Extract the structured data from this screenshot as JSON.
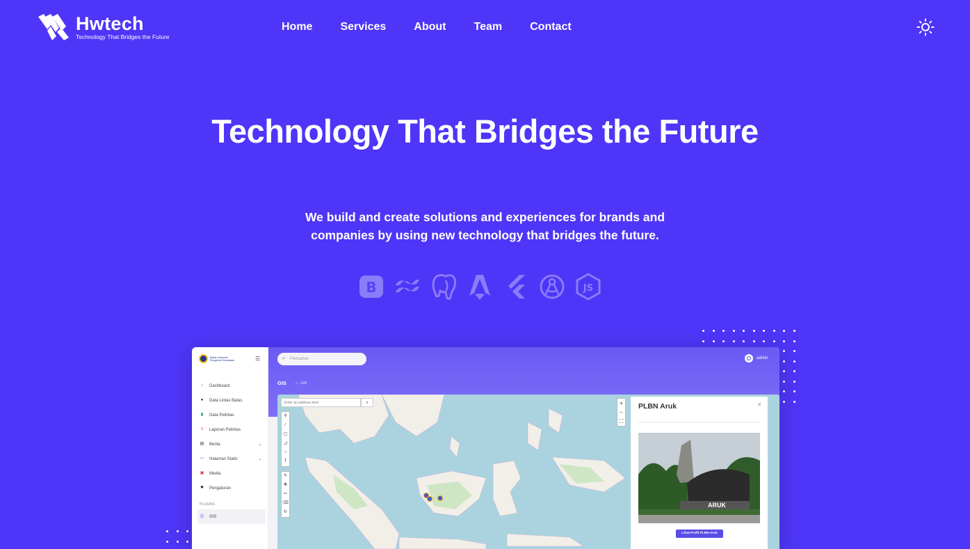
{
  "brand": {
    "name": "Hwtech",
    "tagline": "Technology That Bridges the Future"
  },
  "nav": {
    "items": [
      {
        "label": "Home"
      },
      {
        "label": "Services"
      },
      {
        "label": "About"
      },
      {
        "label": "Team"
      },
      {
        "label": "Contact"
      }
    ],
    "theme_toggle_icon": "sun-icon"
  },
  "hero": {
    "title": "Technology That Bridges the Future",
    "subtitle": "We build and create solutions and experiences for brands and companies by using new technology that bridges the future."
  },
  "tech_stack": {
    "icons": [
      "bootstrap-icon",
      "tailwind-icon",
      "postgresql-icon",
      "astro-icon",
      "flutter-icon",
      "compass-icon",
      "nodejs-icon"
    ],
    "color": "#8b7cf9"
  },
  "colors": {
    "background": "#4f35f7",
    "accent": "#6a5af5"
  },
  "mockup": {
    "sidebar": {
      "brand_text": "Badan Nasional Pengelola Perbatasan",
      "menu": [
        {
          "label": "Dashboard",
          "icon": "home-icon"
        },
        {
          "label": "Data Lintas Batas",
          "icon": "pin-icon"
        },
        {
          "label": "Data Pelintas",
          "icon": "walker-icon"
        },
        {
          "label": "Laporan Pelintas",
          "icon": "list-icon"
        },
        {
          "label": "Berita",
          "icon": "news-icon",
          "caret": "⌄"
        },
        {
          "label": "Halaman Statis",
          "icon": "page-icon",
          "caret": "⌄"
        },
        {
          "label": "Media",
          "icon": "image-icon"
        },
        {
          "label": "Pengaturan",
          "icon": "gear-icon"
        }
      ],
      "section_label": "PLUGINS",
      "plugin_item": "GIS"
    },
    "header": {
      "search_placeholder": "Pencarian",
      "user": "admin",
      "page_title": "GIS",
      "breadcrumb": "GIS"
    },
    "map": {
      "address_placeholder": "Enter an address here",
      "popup": {
        "title": "PLBN Aruk",
        "close": "×",
        "button": "Lihat Profil PLBN Aruk",
        "sign_text": "ARUK"
      }
    }
  }
}
